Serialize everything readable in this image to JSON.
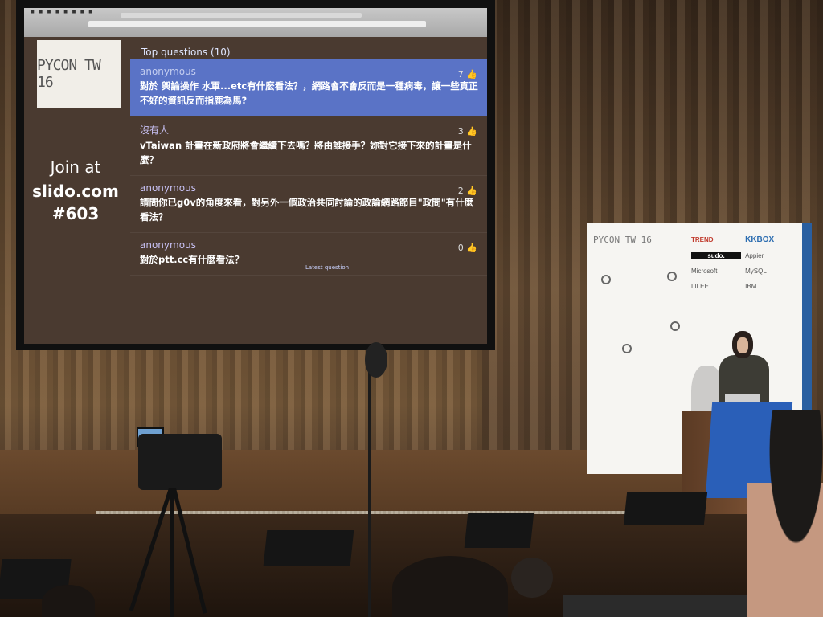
{
  "screen": {
    "logo_text": "PYCON TW 16",
    "join": {
      "line1": "Join at",
      "line2": "slido.com",
      "line3": "#603"
    },
    "header": "Top questions (10)",
    "questions": [
      {
        "author": "anonymous",
        "votes": "7",
        "text": "對於 輿論操作 水軍...etc有什麼看法？，網路會不會反而是一種病毒，讓一些真正不好的資訊反而指鹿為馬?"
      },
      {
        "author": "沒有人",
        "votes": "3",
        "text": "vTaiwan 計畫在新政府將會繼續下去嗎？將由誰接手？妳對它接下來的計畫是什麼？"
      },
      {
        "author": "anonymous",
        "votes": "2",
        "text": "請問你已g0v的角度來看，對另外一個政治共同討論的政論網路節目\"政問\"有什麼看法？"
      },
      {
        "author": "anonymous",
        "votes": "0",
        "text": "對於ptt.cc有什麼看法？"
      }
    ],
    "latest_label": "Latest question"
  },
  "board": {
    "logo_text": "PYCON TW 16",
    "sponsors": [
      "TREND",
      "KKBOX",
      "sudo.",
      "Appier",
      "Microsoft",
      "MySQL",
      "LILEE",
      "IBM"
    ]
  },
  "colors": {
    "selected_question": "#5a73c6",
    "slide_bg": "#4a3a30",
    "podium": "#2a5fb8"
  }
}
